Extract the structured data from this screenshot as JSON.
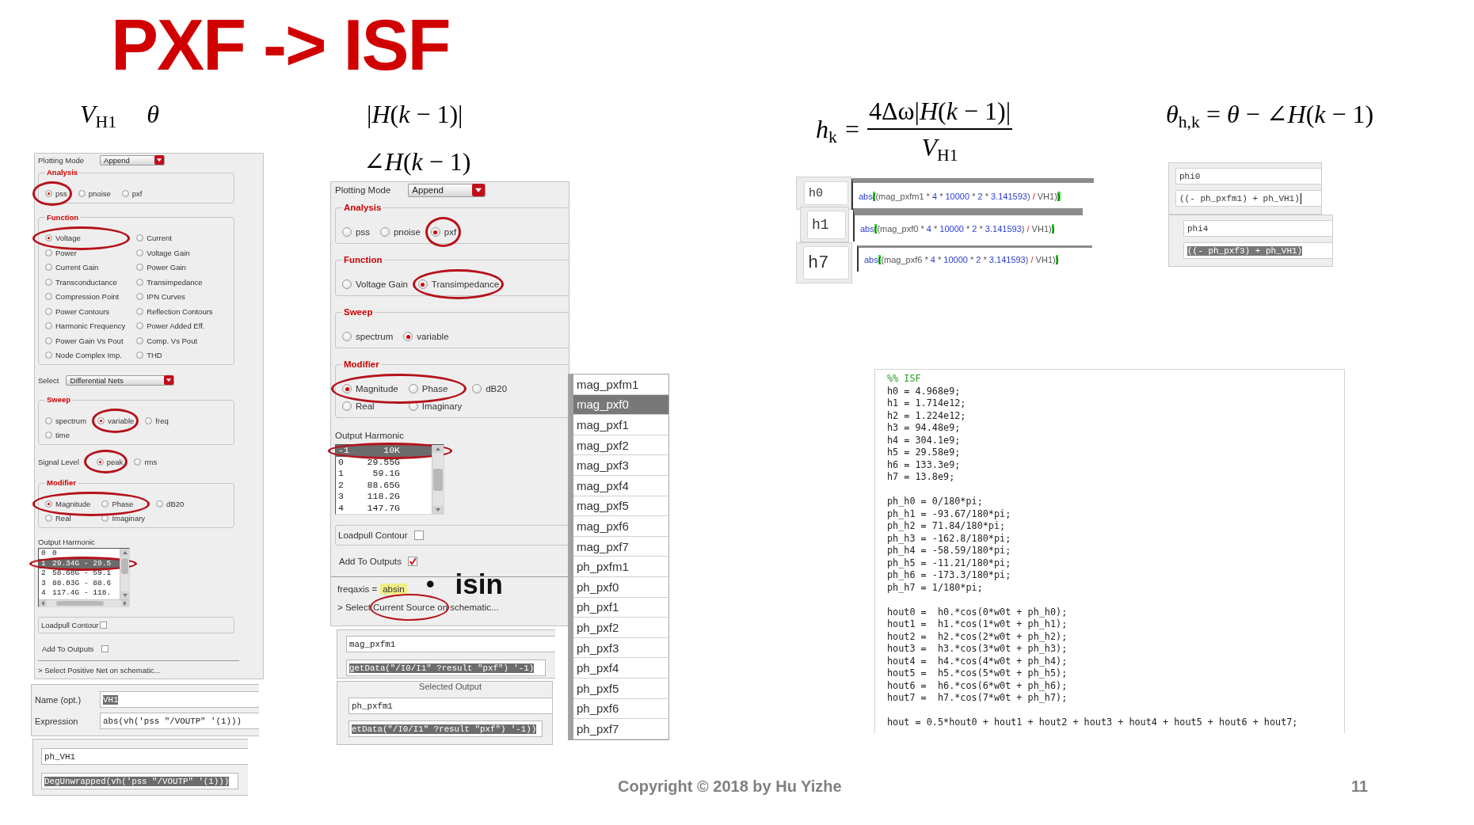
{
  "title": "PXF -> ISF",
  "formulas": {
    "input": [
      "*V*$_{H1}$",
      "*θ*"
    ],
    "transfer": [
      "|*H*(*k* − 1)|",
      "∠*H*(*k* − 1)"
    ],
    "harmonic": {
      "lhs": "*h*$_{k}$",
      "relation": "=",
      "numerator": "4Δω|*H*(*k* − 1)|",
      "denominator": "*V*$_{H1}$"
    },
    "phase": "*θ*$_{h,k}$ = *θ* − ∠*H*(*k* − 1)"
  },
  "settings_panels": [
    {
      "sections": [
        {
          "kind": "dropdown",
          "label": "Plotting Mode",
          "value": "Append"
        },
        {
          "kind": "group",
          "title": "Analysis",
          "rows": [
            [
              {
                "label": "pss",
                "selected": true,
                "circled": true
              },
              {
                "label": "pnoise",
                "selected": false,
                "circled": false
              },
              {
                "label": "pxf",
                "selected": false,
                "circled": false
              }
            ]
          ]
        },
        {
          "kind": "group",
          "title": "Function",
          "rows": [
            [
              {
                "label": "Voltage",
                "selected": true,
                "circled": true
              },
              {
                "label": "Current",
                "selected": false,
                "circled": false
              }
            ],
            [
              {
                "label": "Power",
                "selected": false,
                "circled": false
              },
              {
                "label": "Voltage Gain",
                "selected": false,
                "circled": false
              }
            ],
            [
              {
                "label": "Current Gain",
                "selected": false,
                "circled": false
              },
              {
                "label": "Power Gain",
                "selected": false,
                "circled": false
              }
            ],
            [
              {
                "label": "Transconductance",
                "selected": false,
                "circled": false
              },
              {
                "label": "Transimpedance",
                "selected": false,
                "circled": false
              }
            ],
            [
              {
                "label": "Compression Point",
                "selected": false,
                "circled": false
              },
              {
                "label": "IPN Curves",
                "selected": false,
                "circled": false
              }
            ],
            [
              {
                "label": "Power Contours",
                "selected": false,
                "circled": false
              },
              {
                "label": "Reflection Contours",
                "selected": false,
                "circled": false
              }
            ],
            [
              {
                "label": "Harmonic Frequency",
                "selected": false,
                "circled": false
              },
              {
                "label": "Power Added Eff.",
                "selected": false,
                "circled": false
              }
            ],
            [
              {
                "label": "Power Gain Vs Pout",
                "selected": false,
                "circled": false
              },
              {
                "label": "Comp. Vs Pout",
                "selected": false,
                "circled": false
              }
            ],
            [
              {
                "label": "Node Complex Imp.",
                "selected": false,
                "circled": false
              },
              {
                "label": "THD",
                "selected": false,
                "circled": false
              }
            ]
          ]
        },
        {
          "kind": "dropdown",
          "label": "Select",
          "value": "Differential Nets"
        },
        {
          "kind": "group",
          "title": "Sweep",
          "rows": [
            [
              {
                "label": "spectrum",
                "selected": false,
                "circled": false
              },
              {
                "label": "variable",
                "selected": true,
                "circled": true
              },
              {
                "label": "freq",
                "selected": false,
                "circled": false
              }
            ],
            [
              {
                "label": "time",
                "selected": false,
                "circled": false
              }
            ]
          ]
        },
        {
          "kind": "radios",
          "label": "Signal Level",
          "rows": [
            [
              {
                "label": "peak",
                "selected": true,
                "circled": true
              },
              {
                "label": "rms",
                "selected": false,
                "circled": false
              }
            ]
          ]
        },
        {
          "kind": "group",
          "title": "Modifier",
          "rows": [
            [
              {
                "label": "Magnitude",
                "selected": true,
                "circled": true
              },
              {
                "label": "Phase",
                "selected": false,
                "circled": true
              },
              {
                "label": "dB20",
                "selected": false,
                "circled": false
              }
            ],
            [
              {
                "label": "Real",
                "selected": false,
                "circled": false
              },
              {
                "label": "Imaginary",
                "selected": false,
                "circled": false
              }
            ]
          ]
        },
        {
          "kind": "harmonics",
          "label": "Output Harmonic",
          "rows": [
            {
              "index": "0",
              "value": "0",
              "selected": false,
              "circled": false
            },
            {
              "index": "1",
              "value": "29.34G - 29.5",
              "selected": true,
              "circled": true
            },
            {
              "index": "2",
              "value": "58.68G - 59.1",
              "selected": false,
              "circled": false
            },
            {
              "index": "3",
              "value": "88.03G - 88.6",
              "selected": false,
              "circled": false
            },
            {
              "index": "4",
              "value": "117.4G - 118.",
              "selected": false,
              "circled": false
            }
          ]
        },
        {
          "kind": "checkbox_frame",
          "label": "Loadpull Contour",
          "checked": false
        },
        {
          "kind": "checkbox",
          "label": "Add To Outputs",
          "checked": false
        }
      ],
      "footer": [
        {
          "kind": "link",
          "text": "> Select Positive Net on schematic...",
          "circled": false
        }
      ]
    },
    {
      "sections": [
        {
          "kind": "dropdown",
          "label": "Plotting Mode",
          "value": "Append"
        },
        {
          "kind": "group",
          "title": "Analysis",
          "rows": [
            [
              {
                "label": "pss",
                "selected": false,
                "circled": false
              },
              {
                "label": "pnoise",
                "selected": false,
                "circled": false
              },
              {
                "label": "pxf",
                "selected": true,
                "circled": true
              }
            ]
          ]
        },
        {
          "kind": "group",
          "title": "Function",
          "rows": [
            [
              {
                "label": "Voltage Gain",
                "selected": false,
                "circled": false
              },
              {
                "label": "Transimpedance",
                "selected": true,
                "circled": true
              }
            ]
          ]
        },
        {
          "kind": "group",
          "title": "Sweep",
          "rows": [
            [
              {
                "label": "spectrum",
                "selected": false,
                "circled": false
              },
              {
                "label": "variable",
                "selected": true,
                "circled": false
              }
            ]
          ]
        },
        {
          "kind": "group",
          "title": "Modifier",
          "rows": [
            [
              {
                "label": "Magnitude",
                "selected": true,
                "circled": true
              },
              {
                "label": "Phase",
                "selected": false,
                "circled": true
              },
              {
                "label": "dB20",
                "selected": false,
                "circled": false
              }
            ],
            [
              {
                "label": "Real",
                "selected": false,
                "circled": false
              },
              {
                "label": "Imaginary",
                "selected": false,
                "circled": false
              }
            ]
          ]
        },
        {
          "kind": "harmonics",
          "label": "Output Harmonic",
          "rows": [
            {
              "index": "-1",
              "value": "10K",
              "selected": true,
              "circled": true
            },
            {
              "index": "0",
              "value": "29.55G",
              "selected": false,
              "circled": false
            },
            {
              "index": "1",
              "value": "59.1G",
              "selected": false,
              "circled": false
            },
            {
              "index": "2",
              "value": "88.65G",
              "selected": false,
              "circled": false
            },
            {
              "index": "3",
              "value": "118.2G",
              "selected": false,
              "circled": false
            },
            {
              "index": "4",
              "value": "147.7G",
              "selected": false,
              "circled": false
            }
          ]
        },
        {
          "kind": "checkbox_frame",
          "label": "Loadpull Contour",
          "checked": false
        },
        {
          "kind": "checkbox",
          "label": "Add To Outputs",
          "checked": true
        }
      ],
      "footer": [
        {
          "kind": "setting",
          "label": "freqaxis =",
          "value": "absin",
          "highlighted": true
        },
        {
          "kind": "link",
          "text": "> Select Current Source on schematic...",
          "circled": true
        }
      ]
    }
  ],
  "expression_panels": [
    {
      "fields": [
        {
          "label": "Name (opt.)",
          "value": "VH1",
          "highlighted": true
        },
        {
          "label": "Expression",
          "value": "abs(vh('pss \"/VOUTP\" '(1)))",
          "highlighted": false
        }
      ]
    },
    {
      "fields": [
        {
          "value": "ph_VH1",
          "highlighted": false
        },
        {
          "value": "DegUnwrapped(vh('pss \"/VOUTP\" '(1)))",
          "highlighted": true
        }
      ]
    },
    {
      "fields": [
        {
          "value": "mag_pxfm1",
          "highlighted": false
        },
        {
          "value": "getData(\"/I0/I1\" ?result \"pxf\") '-1)",
          "highlighted": true
        }
      ]
    },
    {
      "caption": "Selected Output",
      "fields": [
        {
          "value": "ph_pxfm1",
          "highlighted": false
        },
        {
          "value": "etData(\"/I0/I1\" ?result \"pxf\") '-1))",
          "highlighted": true
        }
      ]
    }
  ],
  "outputs": [
    {
      "label": "mag_pxfm1",
      "selected": false
    },
    {
      "label": "mag_pxf0",
      "selected": true
    },
    {
      "label": "mag_pxf1",
      "selected": false
    },
    {
      "label": "mag_pxf2",
      "selected": false
    },
    {
      "label": "mag_pxf3",
      "selected": false
    },
    {
      "label": "mag_pxf4",
      "selected": false
    },
    {
      "label": "mag_pxf5",
      "selected": false
    },
    {
      "label": "mag_pxf6",
      "selected": false
    },
    {
      "label": "mag_pxf7",
      "selected": false
    },
    {
      "label": "ph_pxfm1",
      "selected": false
    },
    {
      "label": "ph_pxf0",
      "selected": false
    },
    {
      "label": "ph_pxf1",
      "selected": false
    },
    {
      "label": "ph_pxf2",
      "selected": false
    },
    {
      "label": "ph_pxf3",
      "selected": false
    },
    {
      "label": "ph_pxf4",
      "selected": false
    },
    {
      "label": "ph_pxf5",
      "selected": false
    },
    {
      "label": "ph_pxf6",
      "selected": false
    },
    {
      "label": "ph_pxf7",
      "selected": false
    }
  ],
  "note": {
    "marker": "•",
    "text": "isin"
  },
  "h_rows": [
    {
      "name": "h0",
      "tokens": [
        {
          "text": "abs",
          "kind": "func"
        },
        {
          "text": "(",
          "kind": "match"
        },
        {
          "text": "(mag_pxfm1 * ",
          "kind": "plain"
        },
        {
          "text": "4",
          "kind": "number"
        },
        {
          "text": " * ",
          "kind": "plain"
        },
        {
          "text": "10000",
          "kind": "number"
        },
        {
          "text": " * ",
          "kind": "plain"
        },
        {
          "text": "2",
          "kind": "number"
        },
        {
          "text": " * ",
          "kind": "plain"
        },
        {
          "text": "3.141593",
          "kind": "number"
        },
        {
          "text": ") ",
          "kind": "plain"
        },
        {
          "text": "/",
          "kind": "operator"
        },
        {
          "text": " VH1)",
          "kind": "plain"
        },
        {
          "text": ")",
          "kind": "match"
        }
      ]
    },
    {
      "name": "h1",
      "tokens": [
        {
          "text": "abs",
          "kind": "func"
        },
        {
          "text": "(",
          "kind": "match"
        },
        {
          "text": "(mag_pxf0 * ",
          "kind": "plain"
        },
        {
          "text": "4",
          "kind": "number"
        },
        {
          "text": " * ",
          "kind": "plain"
        },
        {
          "text": "10000",
          "kind": "number"
        },
        {
          "text": " * ",
          "kind": "plain"
        },
        {
          "text": "2",
          "kind": "number"
        },
        {
          "text": " * ",
          "kind": "plain"
        },
        {
          "text": "3.141593",
          "kind": "number"
        },
        {
          "text": ") ",
          "kind": "plain"
        },
        {
          "text": "/",
          "kind": "operator"
        },
        {
          "text": " VH1)",
          "kind": "plain"
        },
        {
          "text": ")",
          "kind": "match"
        }
      ]
    },
    {
      "name": "h7",
      "tokens": [
        {
          "text": "abs",
          "kind": "func"
        },
        {
          "text": "(",
          "kind": "match"
        },
        {
          "text": "(mag_pxf6 * ",
          "kind": "plain"
        },
        {
          "text": "4",
          "kind": "number"
        },
        {
          "text": " * ",
          "kind": "plain"
        },
        {
          "text": "10000",
          "kind": "number"
        },
        {
          "text": " * ",
          "kind": "plain"
        },
        {
          "text": "2",
          "kind": "number"
        },
        {
          "text": " * ",
          "kind": "plain"
        },
        {
          "text": "3.141593",
          "kind": "number"
        },
        {
          "text": ") ",
          "kind": "plain"
        },
        {
          "text": "/",
          "kind": "operator"
        },
        {
          "text": " VH1)",
          "kind": "plain"
        },
        {
          "text": ")",
          "kind": "match"
        }
      ]
    }
  ],
  "phi_panels": [
    {
      "name": "phi0",
      "expression": "((- ph_pxfm1) + ph_VH1)",
      "highlighted": false,
      "cursor": true
    },
    {
      "name": "phi4",
      "expression": "((- ph_pxf3) + ph_VH1)",
      "highlighted": true,
      "cursor": false
    }
  ],
  "isf": {
    "comment": "%% ISF",
    "blocks": [
      [
        "h0 = 4.968e9;",
        "h1 = 1.714e12;",
        "h2 = 1.224e12;",
        "h3 = 94.48e9;",
        "h4 = 304.1e9;",
        "h5 = 29.58e9;",
        "h6 = 133.3e9;",
        "h7 = 13.8e9;"
      ],
      [
        "ph_h0 = 0/180*pi;",
        "ph_h1 = -93.67/180*pi;",
        "ph_h2 = 71.84/180*pi;",
        "ph_h3 = -162.8/180*pi;",
        "ph_h4 = -58.59/180*pi;",
        "ph_h5 = -11.21/180*pi;",
        "ph_h6 = -173.3/180*pi;",
        "ph_h7 = 1/180*pi;"
      ],
      [
        "hout0 =  h0.*cos(0*w0t + ph_h0);",
        "hout1 =  h1.*cos(1*w0t + ph_h1);",
        "hout2 =  h2.*cos(2*w0t + ph_h2);",
        "hout3 =  h3.*cos(3*w0t + ph_h3);",
        "hout4 =  h4.*cos(4*w0t + ph_h4);",
        "hout5 =  h5.*cos(5*w0t + ph_h5);",
        "hout6 =  h6.*cos(6*w0t + ph_h6);",
        "hout7 =  h7.*cos(7*w0t + ph_h7);"
      ],
      [
        "hout = 0.5*hout0 + hout1 + hout2 + hout3 + hout4 + hout5 + hout6 + hout7;"
      ]
    ]
  },
  "footer": {
    "copyright": "Copyright © 2018 by Hu Yizhe",
    "page": "11"
  }
}
